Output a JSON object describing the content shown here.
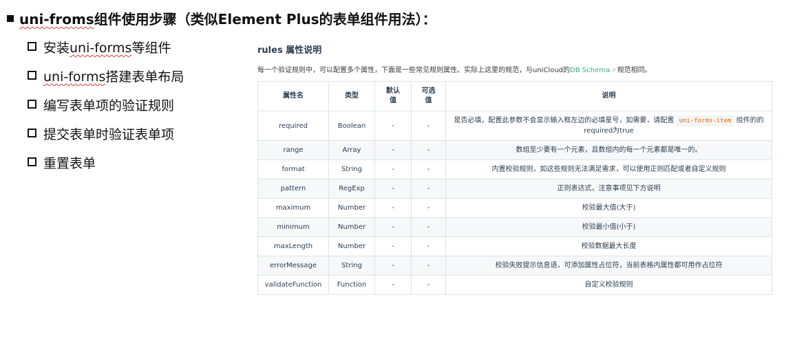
{
  "heading": {
    "marker": "■",
    "prefix": "uni-froms",
    "rest": "组件使用步骤（类似Element Plus的表单组件用法）："
  },
  "steps": [
    {
      "pre": "安装",
      "mark": "uni-forms",
      "post": "等组件"
    },
    {
      "pre": "",
      "mark": "uni-forms",
      "post": "搭建表单布局"
    },
    {
      "pre": "编写表单项的验证规则",
      "mark": "",
      "post": ""
    },
    {
      "pre": "提交表单时验证表单项",
      "mark": "",
      "post": ""
    },
    {
      "pre": "重置表单",
      "mark": "",
      "post": ""
    }
  ],
  "doc": {
    "title": "rules 属性说明",
    "desc_before": "每一个验证规则中，可以配置多个属性，下面是一些常见规则属性。实际上这里的规范，与uniCloud的",
    "desc_link": "DB Schema",
    "desc_after": "规范相同。"
  },
  "table": {
    "headers": [
      {
        "line1": "属性名",
        "line2": ""
      },
      {
        "line1": "类型",
        "line2": ""
      },
      {
        "line1": "默认",
        "line2": "值"
      },
      {
        "line1": "可选",
        "line2": "值"
      },
      {
        "line1": "说明",
        "line2": ""
      }
    ],
    "rows": [
      {
        "name": "required",
        "type": "Boolean",
        "default": "-",
        "options": "-",
        "desc_pre": "是否必填，配置此参数不会显示输入框左边的必填星号，如需要，请配置",
        "desc_code": "uni-forms-item",
        "desc_post": "组件的的required为true"
      },
      {
        "name": "range",
        "type": "Array",
        "default": "-",
        "options": "-",
        "desc_pre": "数组至少要有一个元素，且数组内的每一个元素都是唯一的。",
        "desc_code": "",
        "desc_post": ""
      },
      {
        "name": "format",
        "type": "String",
        "default": "-",
        "options": "-",
        "desc_pre": "内置校验规则，如这些规则无法满足需求，可以使用正则匹配或者自定义规则",
        "desc_code": "",
        "desc_post": ""
      },
      {
        "name": "pattern",
        "type": "RegExp",
        "default": "-",
        "options": "-",
        "desc_pre": "正则表达式，注意事项见下方说明",
        "desc_code": "",
        "desc_post": ""
      },
      {
        "name": "maximum",
        "type": "Number",
        "default": "-",
        "options": "-",
        "desc_pre": "校验最大值(大于)",
        "desc_code": "",
        "desc_post": ""
      },
      {
        "name": "minimum",
        "type": "Number",
        "default": "-",
        "options": "-",
        "desc_pre": "校验最小值(小于)",
        "desc_code": "",
        "desc_post": ""
      },
      {
        "name": "maxLength",
        "type": "Number",
        "default": "-",
        "options": "-",
        "desc_pre": "校验数据最大长度",
        "desc_code": "",
        "desc_post": ""
      },
      {
        "name": "errorMessage",
        "type": "String",
        "default": "-",
        "options": "-",
        "desc_pre": "校验失败提示信息语，可添加属性占位符，当前表格内属性都可用作占位符",
        "desc_code": "",
        "desc_post": ""
      },
      {
        "name": "validateFunction",
        "type": "Function",
        "default": "-",
        "options": "-",
        "desc_pre": "自定义校验规则",
        "desc_code": "",
        "desc_post": ""
      }
    ]
  }
}
